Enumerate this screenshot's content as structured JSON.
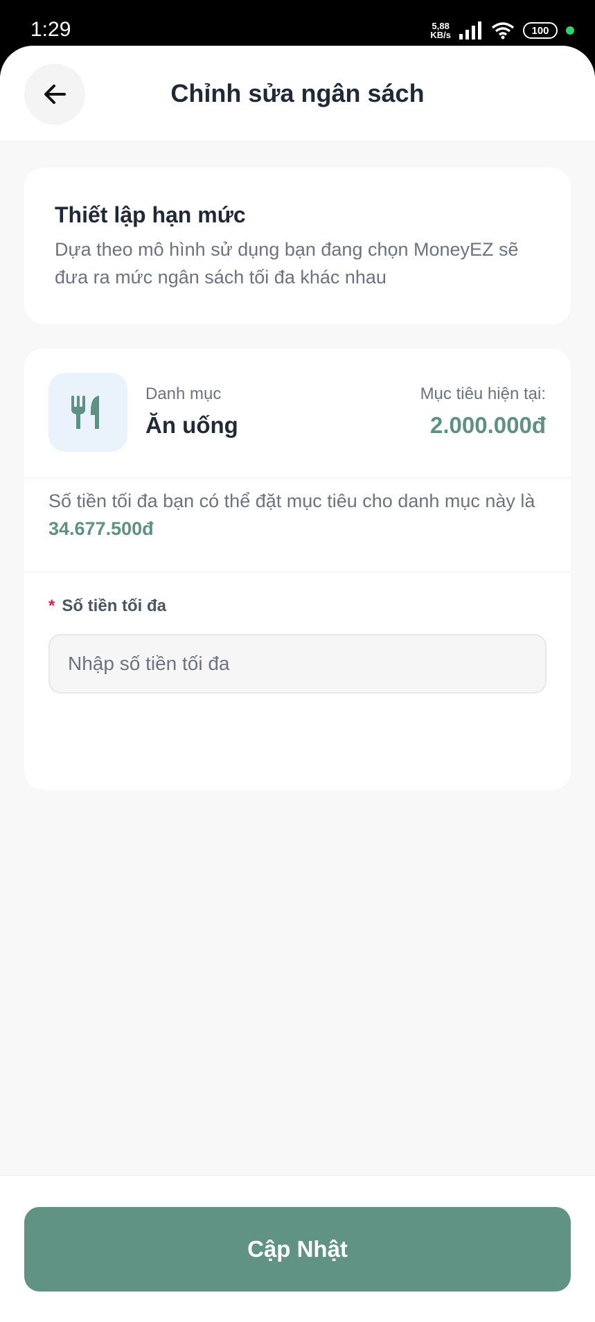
{
  "status_bar": {
    "time": "1:29",
    "net_speed_value": "5,88",
    "net_speed_unit": "KB/s",
    "battery": "100"
  },
  "header": {
    "back_icon": "arrow-left-icon",
    "title": "Chỉnh sửa ngân sách"
  },
  "intro": {
    "title": "Thiết lập hạn mức",
    "description": "Dựa theo mô hình sử dụng bạn đang chọn MoneyEZ sẽ đưa ra mức ngân sách tối đa khác nhau"
  },
  "category": {
    "icon": "utensils-icon",
    "label": "Danh mục",
    "name": "Ăn uống",
    "goal_label": "Mục tiêu hiện tại:",
    "goal_value": "2.000.000đ"
  },
  "max_info": {
    "text": "Số tiền tối đa bạn có thể đặt mục tiêu cho danh mục này là ",
    "amount": "34.677.500đ"
  },
  "field": {
    "required_mark": "*",
    "label": "Số tiền tối đa",
    "placeholder": "Nhập số tiền tối đa",
    "value": ""
  },
  "footer": {
    "button_label": "Cập Nhật"
  },
  "colors": {
    "accent": "#619384",
    "accent_text": "#5f9183",
    "icon_bg": "#eaf2fb",
    "required": "#e11d48"
  }
}
